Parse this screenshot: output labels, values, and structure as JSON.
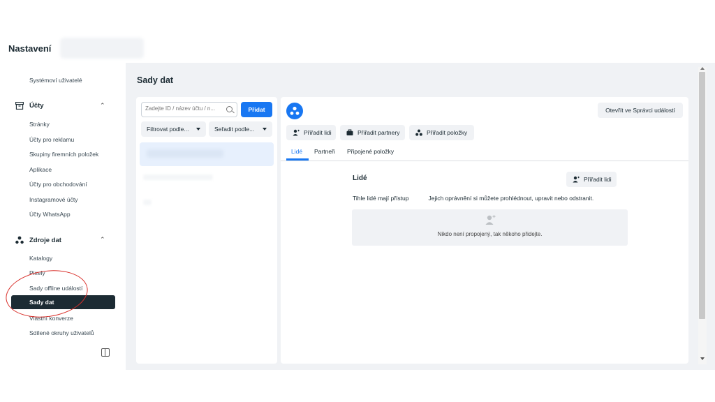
{
  "app": {
    "title": "Nastavení"
  },
  "sidebar": {
    "top_item": "Systémoví uživatelé",
    "sections": [
      {
        "label": "Účty",
        "icon": "archive-box-icon",
        "items": [
          "Stránky",
          "Účty pro reklamu",
          "Skupiny firemních položek",
          "Aplikace",
          "Účty pro obchodování",
          "Instagramové účty",
          "Účty WhatsApp"
        ]
      },
      {
        "label": "Zdroje dat",
        "icon": "data-sources-icon",
        "items": [
          "Katalogy",
          "Pixely",
          "Sady offline událostí",
          "Sady dat",
          "Vlastní konverze",
          "Sdílené okruhy uživatelů"
        ]
      }
    ],
    "active_item": "Sady dat"
  },
  "page": {
    "title": "Sady dat"
  },
  "list_panel": {
    "search_placeholder": "Zadejte ID / název účtu / n...",
    "add_button": "Přidat",
    "filter_label": "Filtrovat podle...",
    "sort_label": "Seřadit podle..."
  },
  "detail_panel": {
    "open_button": "Otevřít ve Správci událostí",
    "actions": [
      "Přiřadit lidi",
      "Přiřadit partnery",
      "Přiřadit položky"
    ],
    "tabs": [
      "Lidé",
      "Partneři",
      "Připojené položky"
    ],
    "active_tab": "Lidé",
    "people": {
      "title": "Lidé",
      "assign_button": "Přiřadit lidi",
      "description_prefix": "Tihle lidé mají přístup",
      "description_suffix": "Jejich oprávnění si můžete prohlédnout, upravit nebo odstranit.",
      "empty_text": "Nikdo není propojený, tak někoho přidejte."
    }
  },
  "colors": {
    "accent": "#1877f2",
    "active_nav": "#1c2b33",
    "annotation": "#d9302b"
  }
}
